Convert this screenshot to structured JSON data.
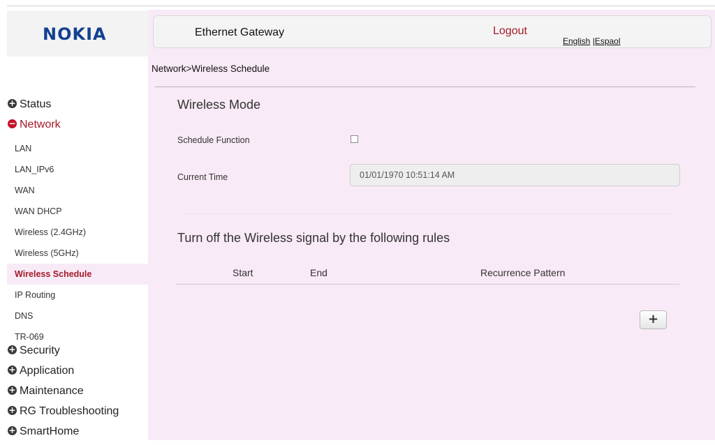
{
  "brand": {
    "logo_text": "NOKIA",
    "color": "#124191"
  },
  "header": {
    "title": "Ethernet Gateway",
    "logout_label": "Logout",
    "lang_english": "English",
    "lang_separator": "|",
    "lang_spanish": "Espaol"
  },
  "breadcrumb": "Network>Wireless Schedule",
  "sidebar": {
    "top_categories": [
      {
        "label": "Status",
        "icon": "plus-circle-icon",
        "expanded": false
      },
      {
        "label": "Network",
        "icon": "minus-circle-icon",
        "expanded": true
      }
    ],
    "network_items": [
      {
        "label": "LAN"
      },
      {
        "label": "LAN_IPv6"
      },
      {
        "label": "WAN"
      },
      {
        "label": "WAN DHCP"
      },
      {
        "label": "Wireless (2.4GHz)"
      },
      {
        "label": "Wireless (5GHz)"
      },
      {
        "label": "Wireless Schedule",
        "active": true
      },
      {
        "label": "IP Routing"
      },
      {
        "label": "DNS"
      },
      {
        "label": "TR-069"
      }
    ],
    "bottom_categories": [
      {
        "label": "Security",
        "icon": "plus-circle-icon"
      },
      {
        "label": "Application",
        "icon": "plus-circle-icon"
      },
      {
        "label": "Maintenance",
        "icon": "plus-circle-icon"
      },
      {
        "label": "RG Troubleshooting",
        "icon": "plus-circle-icon"
      },
      {
        "label": "SmartHome",
        "icon": "plus-circle-icon"
      }
    ]
  },
  "wireless_mode": {
    "title": "Wireless Mode",
    "schedule_label": "Schedule Function",
    "schedule_checked": false,
    "current_time_label": "Current Time",
    "current_time_value": "01/01/1970 10:51:14 AM"
  },
  "rules": {
    "title": "Turn off the Wireless signal by the following rules",
    "columns": [
      "Start",
      "End",
      "Recurrence Pattern"
    ],
    "add_button_label": "+"
  },
  "colors": {
    "accent": "#a31a2a",
    "main_bg": "#f8eaf6"
  }
}
